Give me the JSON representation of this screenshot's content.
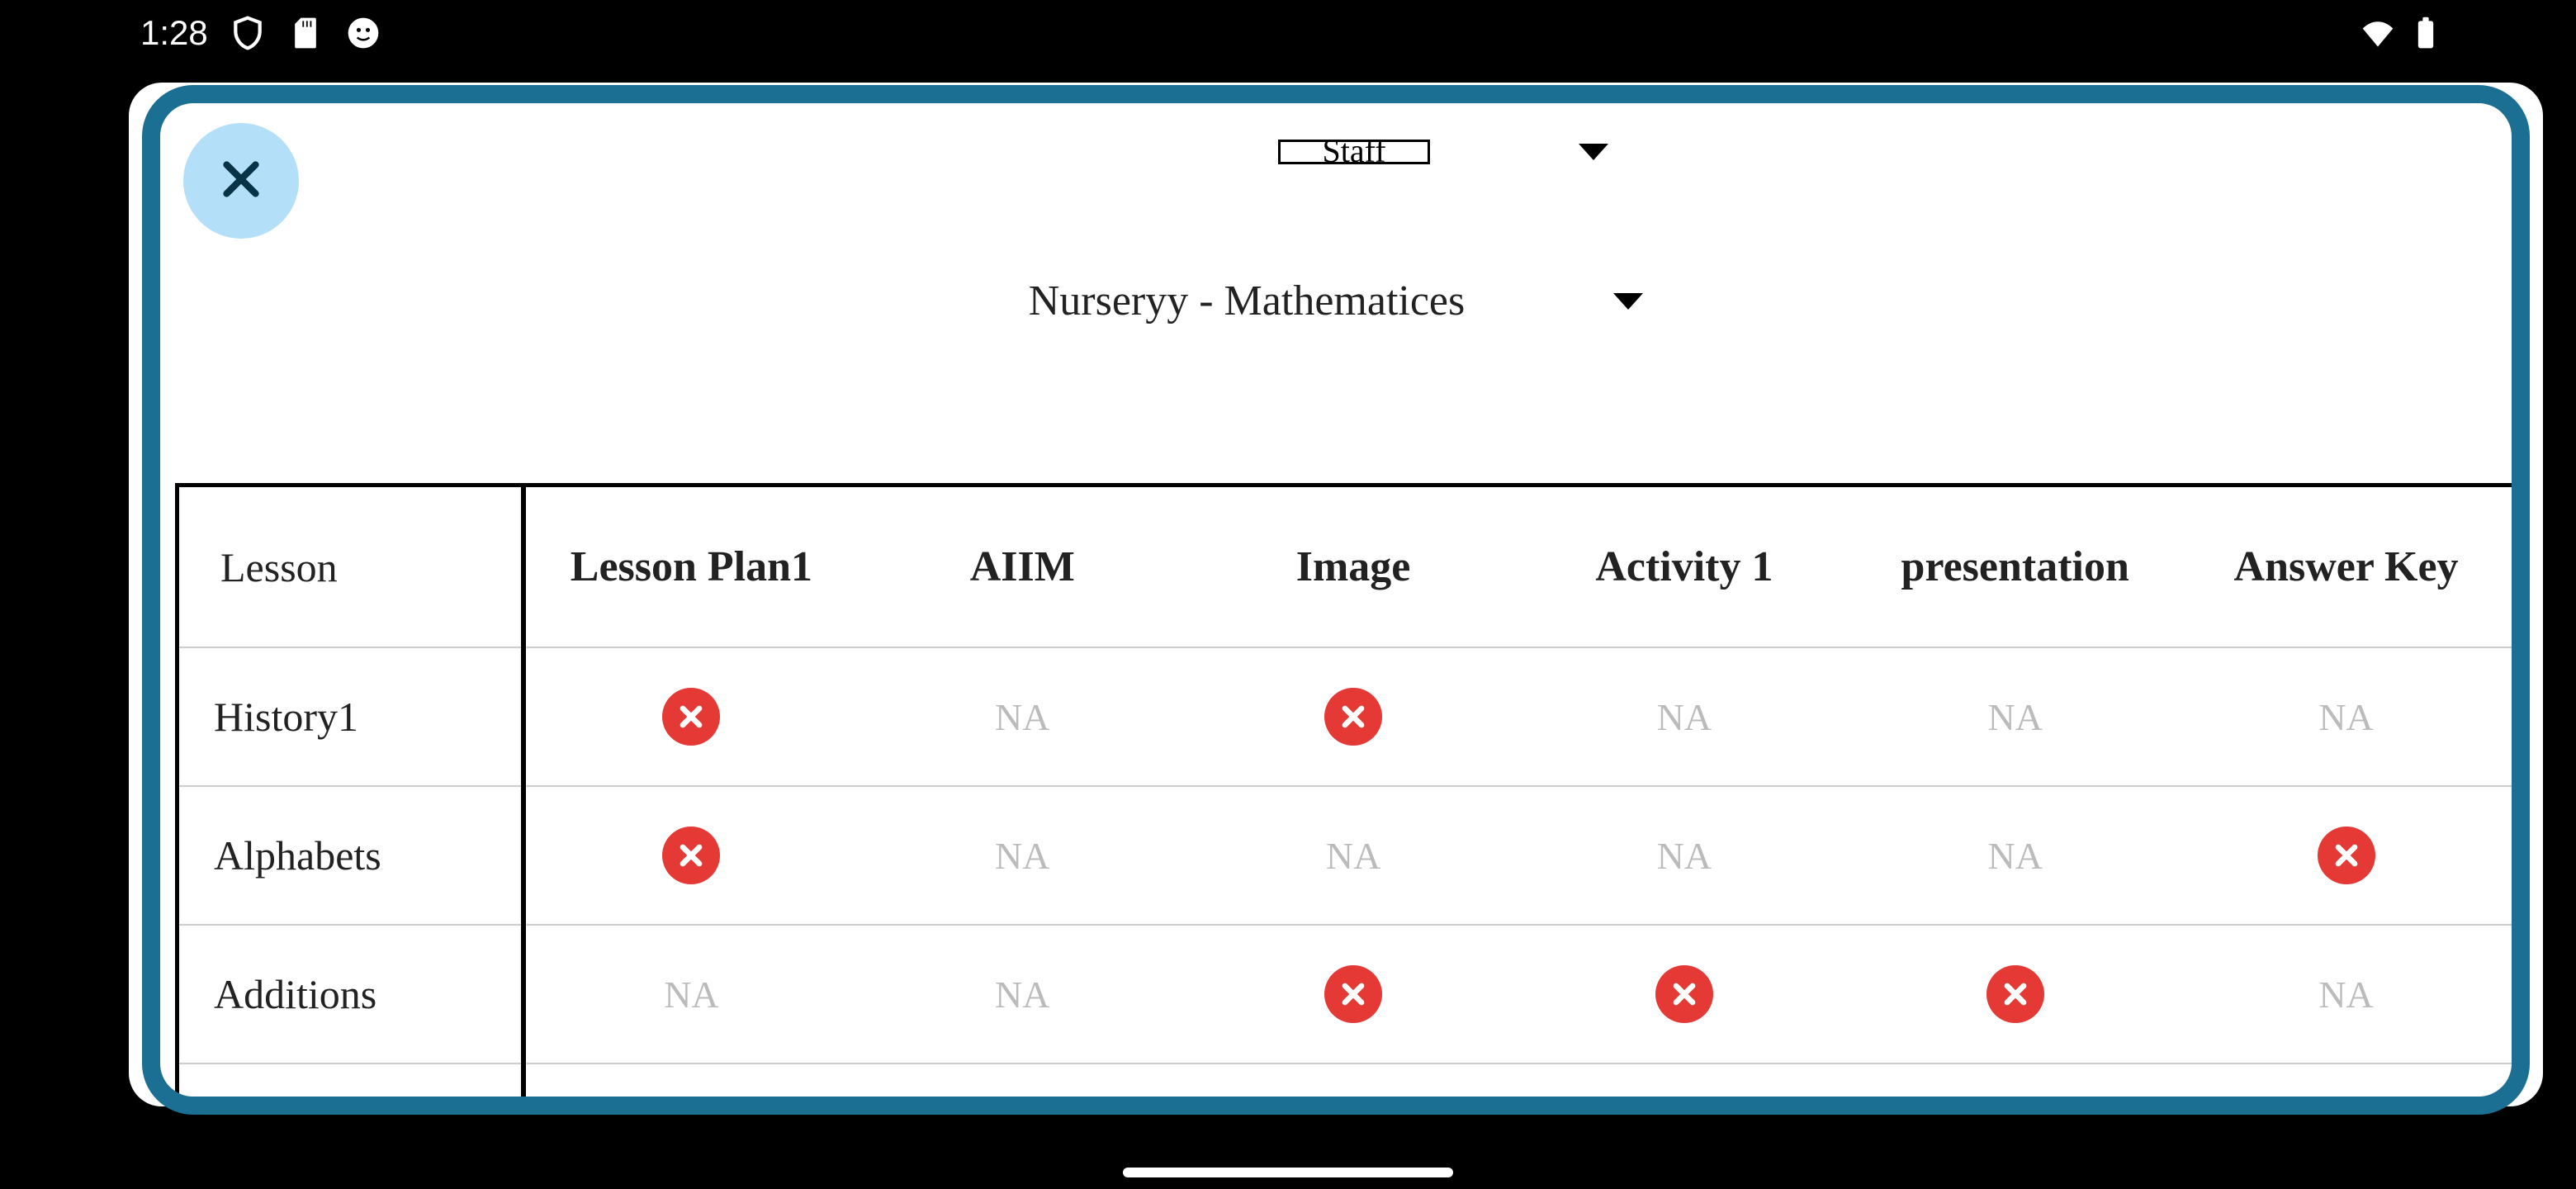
{
  "status": {
    "time": "1:28"
  },
  "dropdowns": {
    "top_label": "Staff",
    "main_label": "Nurseryy - Mathematices"
  },
  "table": {
    "lesson_header": "Lesson",
    "columns": [
      "Lesson Plan1",
      "AIIM",
      "Image",
      "Activity 1",
      "presentation",
      "Answer Key"
    ],
    "rows": [
      {
        "lesson": "History1",
        "cells": [
          "X",
          "NA",
          "X",
          "NA",
          "NA",
          "NA"
        ]
      },
      {
        "lesson": "Alphabets",
        "cells": [
          "X",
          "NA",
          "NA",
          "NA",
          "NA",
          "X"
        ]
      },
      {
        "lesson": "Additions",
        "cells": [
          "NA",
          "NA",
          "X",
          "X",
          "X",
          "NA"
        ]
      }
    ],
    "na_text": "NA"
  }
}
